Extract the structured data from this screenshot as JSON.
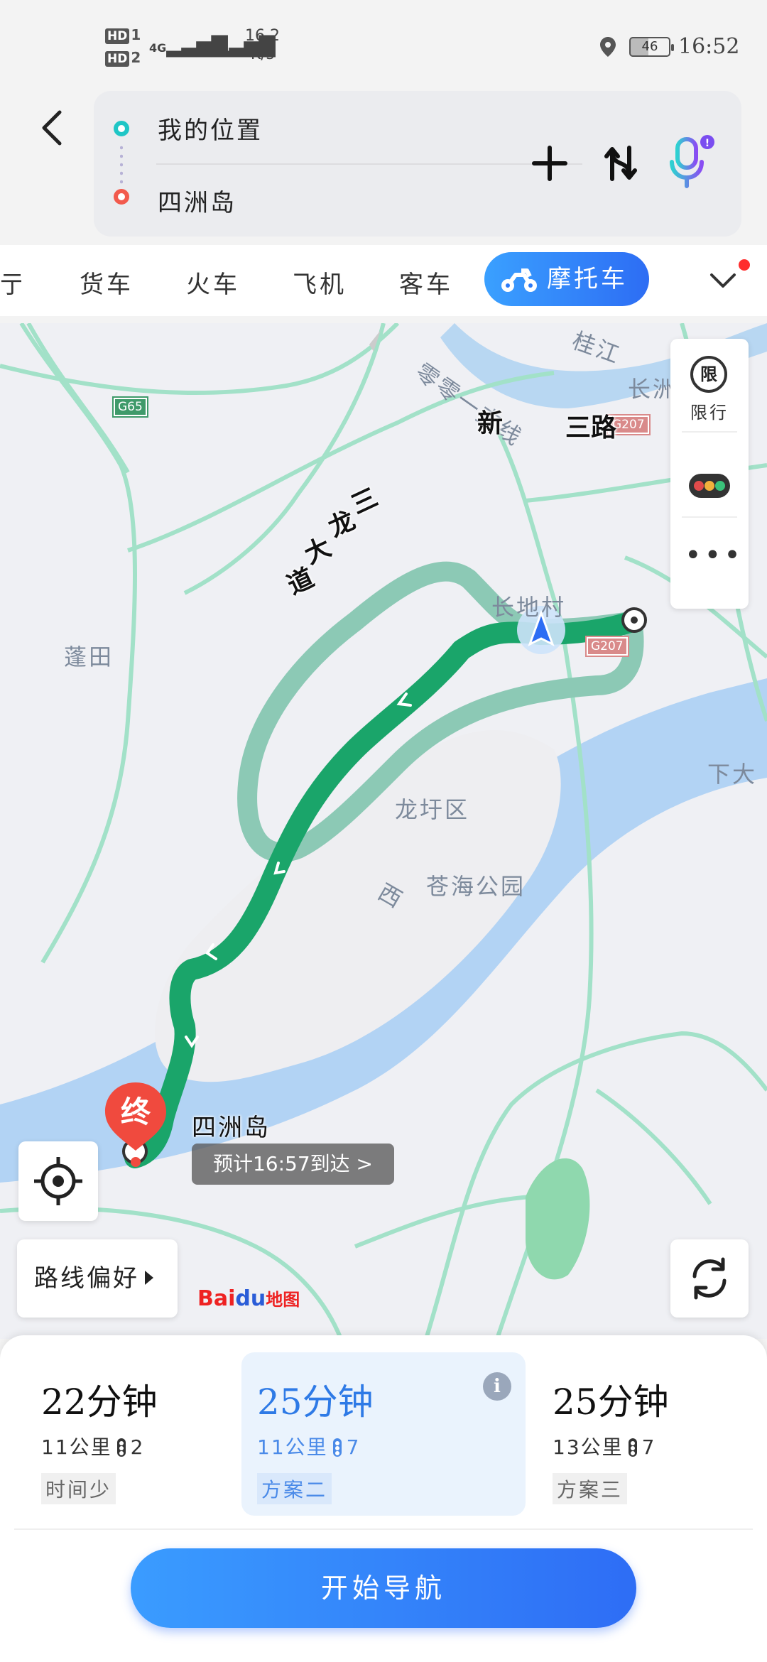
{
  "status_bar": {
    "hd1": "HD",
    "hd1_num": "1",
    "hd2": "HD",
    "hd2_num": "2",
    "net1": "4G",
    "net2": "4G",
    "speed_value": "16.2",
    "speed_unit": "K/s",
    "battery": "46",
    "time": "16:52"
  },
  "search": {
    "from": "我的位置",
    "to": "四洲岛"
  },
  "tabs": {
    "partial": "亍",
    "items": [
      "货车",
      "火车",
      "飞机",
      "客车"
    ],
    "active": "摩托车"
  },
  "map": {
    "labels": {
      "guijiang": "桂江",
      "lingling": "零零一支线",
      "changzhou": "长洲",
      "penggtian": "蓬田",
      "changdi": "长地村",
      "longxu": "龙圩区",
      "cangehai": "苍海公园",
      "xiada": "下大",
      "xi": "西"
    },
    "shields": {
      "g207_top": "G207",
      "g207_mid": "G207",
      "g65": "G65"
    },
    "roads": {
      "xin": "新",
      "sanlu": "三路",
      "sanlong_1": "三",
      "sanlong_2": "龙",
      "sanlong_3": "大",
      "sanlong_4": "道"
    },
    "tools": {
      "xianxing_icon": "限",
      "xianxing": "限行"
    },
    "destination_pin": "终",
    "destination_name": "四洲岛",
    "eta": "预计16:57到达 >",
    "route_pref": "路线偏好",
    "logo_bai": "Bai",
    "logo_du": "du",
    "logo_map": "地图"
  },
  "plans": [
    {
      "time": "22分钟",
      "distance": "11公里",
      "lights": "2",
      "tag": "时间少"
    },
    {
      "time": "25分钟",
      "distance": "11公里",
      "lights": "7",
      "tag": "方案二"
    },
    {
      "time": "25分钟",
      "distance": "13公里",
      "lights": "7",
      "tag": "方案三"
    }
  ],
  "info_icon": "i",
  "start_nav": "开始导航",
  "colors": {
    "accent": "#2e6df5",
    "route_main": "#1aa56a",
    "route_alt": "#8cc9b5",
    "river": "#b2d3f4",
    "road": "#9fe0c6"
  }
}
